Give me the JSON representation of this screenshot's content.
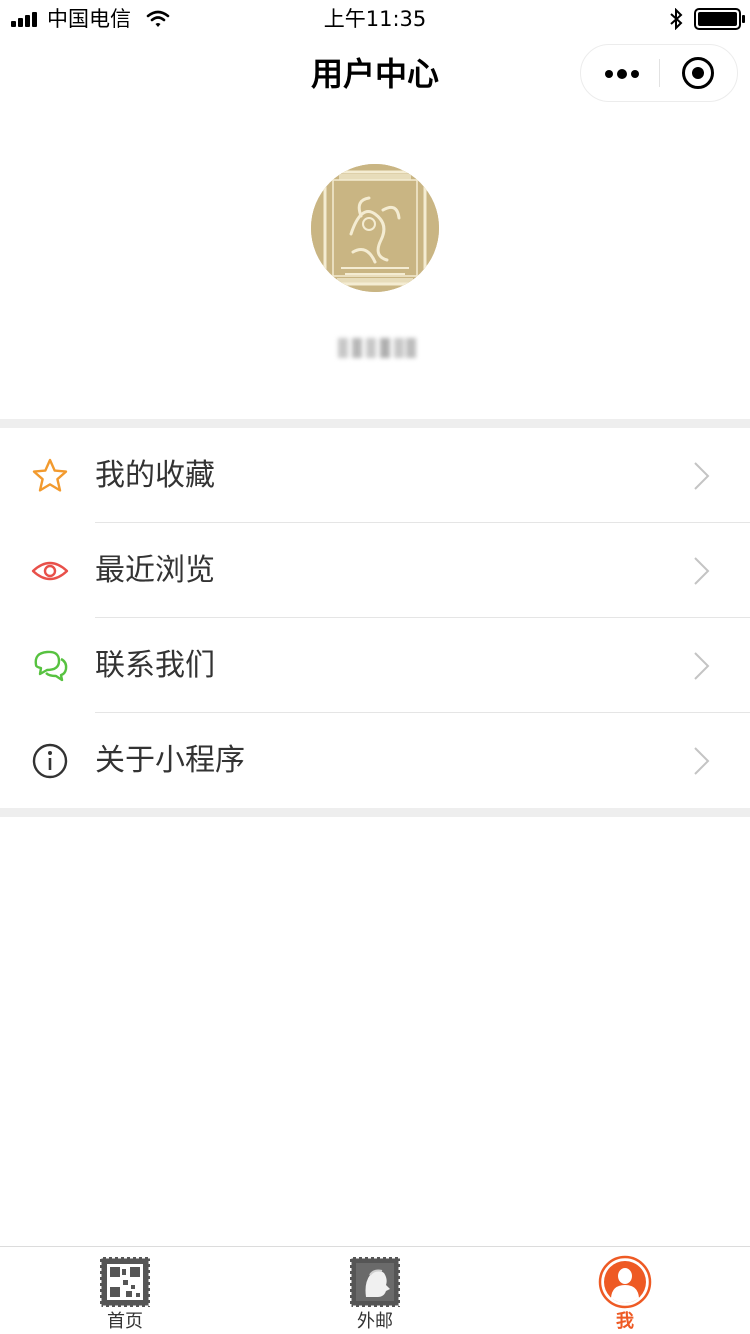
{
  "status_bar": {
    "carrier": "中国电信",
    "time": "上午11:35"
  },
  "nav": {
    "title": "用户中心"
  },
  "profile": {
    "avatar_icon": "stamp-dragon-avatar",
    "username_obscured": true
  },
  "menu": {
    "items": [
      {
        "label": "我的收藏",
        "icon": "star-icon",
        "color": "#f29a2e"
      },
      {
        "label": "最近浏览",
        "icon": "eye-icon",
        "color": "#e8504a"
      },
      {
        "label": "联系我们",
        "icon": "chat-bubbles-icon",
        "color": "#57c240"
      },
      {
        "label": "关于小程序",
        "icon": "info-icon",
        "color": "#333333"
      }
    ]
  },
  "tabbar": {
    "tabs": [
      {
        "label": "首页",
        "icon": "stamp-qr-icon",
        "active": false
      },
      {
        "label": "外邮",
        "icon": "stamp-portrait-icon",
        "active": false
      },
      {
        "label": "我",
        "icon": "user-icon",
        "active": true
      }
    ],
    "active_color": "#ee5a24"
  }
}
